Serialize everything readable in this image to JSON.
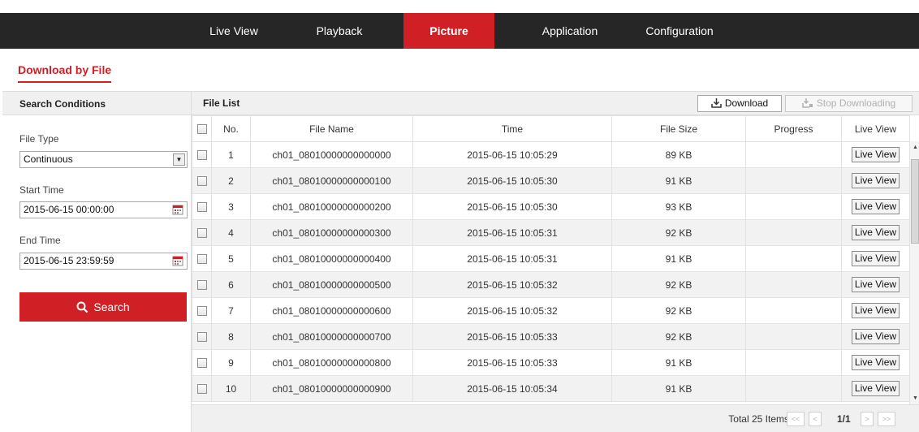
{
  "nav": {
    "tabs": [
      {
        "label": "Live View",
        "active": false
      },
      {
        "label": "Playback",
        "active": false
      },
      {
        "label": "Picture",
        "active": true
      },
      {
        "label": "Application",
        "active": false
      },
      {
        "label": "Configuration",
        "active": false
      }
    ]
  },
  "subtab": {
    "label": "Download by File"
  },
  "search": {
    "header": "Search Conditions",
    "file_type_label": "File Type",
    "file_type_value": "Continuous",
    "start_time_label": "Start Time",
    "start_time_value": "2015-06-15 00:00:00",
    "end_time_label": "End Time",
    "end_time_value": "2015-06-15 23:59:59",
    "button_label": "Search"
  },
  "file_list": {
    "title": "File List",
    "download_label": "Download",
    "stop_label": "Stop Downloading",
    "columns": {
      "no": "No.",
      "file_name": "File Name",
      "time": "Time",
      "file_size": "File Size",
      "progress": "Progress",
      "live_view": "Live View"
    },
    "row_button_label": "Live View",
    "rows": [
      {
        "no": "1",
        "file_name": "ch01_08010000000000000",
        "time": "2015-06-15 10:05:29",
        "size": "89 KB",
        "progress": ""
      },
      {
        "no": "2",
        "file_name": "ch01_08010000000000100",
        "time": "2015-06-15 10:05:30",
        "size": "91 KB",
        "progress": ""
      },
      {
        "no": "3",
        "file_name": "ch01_08010000000000200",
        "time": "2015-06-15 10:05:30",
        "size": "93 KB",
        "progress": ""
      },
      {
        "no": "4",
        "file_name": "ch01_08010000000000300",
        "time": "2015-06-15 10:05:31",
        "size": "92 KB",
        "progress": ""
      },
      {
        "no": "5",
        "file_name": "ch01_08010000000000400",
        "time": "2015-06-15 10:05:31",
        "size": "91 KB",
        "progress": ""
      },
      {
        "no": "6",
        "file_name": "ch01_08010000000000500",
        "time": "2015-06-15 10:05:32",
        "size": "92 KB",
        "progress": ""
      },
      {
        "no": "7",
        "file_name": "ch01_08010000000000600",
        "time": "2015-06-15 10:05:32",
        "size": "92 KB",
        "progress": ""
      },
      {
        "no": "8",
        "file_name": "ch01_08010000000000700",
        "time": "2015-06-15 10:05:33",
        "size": "92 KB",
        "progress": ""
      },
      {
        "no": "9",
        "file_name": "ch01_08010000000000800",
        "time": "2015-06-15 10:05:33",
        "size": "91 KB",
        "progress": ""
      },
      {
        "no": "10",
        "file_name": "ch01_08010000000000900",
        "time": "2015-06-15 10:05:34",
        "size": "91 KB",
        "progress": ""
      }
    ]
  },
  "pagination": {
    "total": "Total 25 Items",
    "first": "<<",
    "prev": "<",
    "page": "1/1",
    "next": ">",
    "last": ">>"
  },
  "colors": {
    "accent": "#d11f26",
    "nav_bg": "#262626",
    "panel_bg": "#f0f0f0"
  }
}
